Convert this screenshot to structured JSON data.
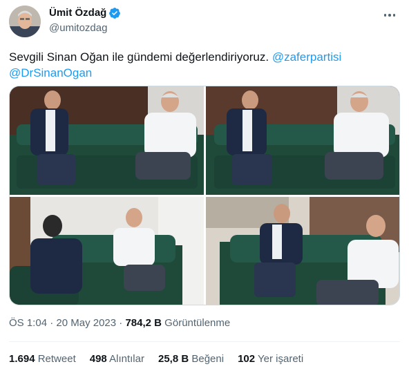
{
  "author": {
    "name": "Ümit Özdağ",
    "handle": "@umitozdag",
    "verified_color": "#1d9bf0"
  },
  "tweet": {
    "text_plain": "Sevgili Sinan Oğan ile gündemi değerlendiriyoruz. ",
    "mention_1": "@zaferpartisi",
    "mention_2": "@DrSinanOgan"
  },
  "media": {
    "photos": [
      "meeting-photo-1",
      "meeting-photo-2",
      "meeting-photo-3",
      "meeting-photo-4"
    ]
  },
  "meta": {
    "time": "ÖS 1:04",
    "sep1": " · ",
    "date": "20 May 2023",
    "sep2": " · ",
    "views_count": "784,2 B",
    "views_label": " Görüntülenme"
  },
  "stats": {
    "retweets": {
      "count": "1.694",
      "label": "Retweet"
    },
    "quotes": {
      "count": "498",
      "label": "Alıntılar"
    },
    "likes": {
      "count": "25,8 B",
      "label": "Beğeni"
    },
    "bookmarks": {
      "count": "102",
      "label": "Yer işareti"
    }
  },
  "colors": {
    "accent": "#1d9bf0",
    "text": "#0f1419",
    "secondary": "#536471",
    "sofa": "#1f4a3a"
  }
}
